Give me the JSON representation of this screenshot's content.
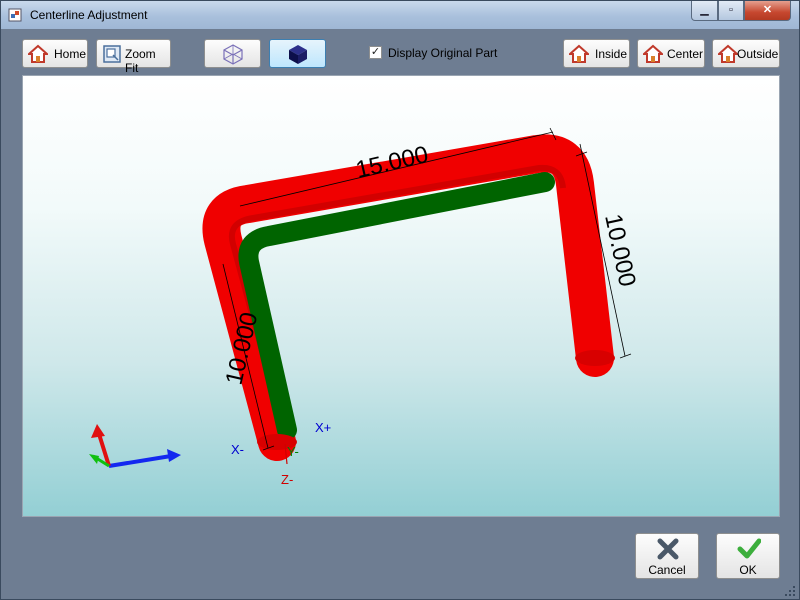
{
  "window": {
    "title": "Centerline Adjustment",
    "minimize": "▁",
    "maximize": "▫",
    "close": "✕"
  },
  "toolbar": {
    "home_label": "Home",
    "zoom_fit_label": "Zoom Fit",
    "display_original_label": "Display Original Part",
    "display_original_checked": "✓",
    "inside_label": "Inside",
    "center_label": "Center",
    "outside_label": "Outside"
  },
  "viewport": {
    "dimensions": [
      {
        "name": "top",
        "value": "15.000"
      },
      {
        "name": "right",
        "value": "10.000"
      },
      {
        "name": "left",
        "value": "10.000"
      }
    ],
    "end_labels": {
      "x_plus": "X+",
      "x_minus": "X-",
      "y_minus": "Y-",
      "z_minus": "Z-"
    },
    "tube_color": "#f00000",
    "centerline_color": "#006400"
  },
  "footer": {
    "cancel_label": "Cancel",
    "ok_label": "OK"
  }
}
